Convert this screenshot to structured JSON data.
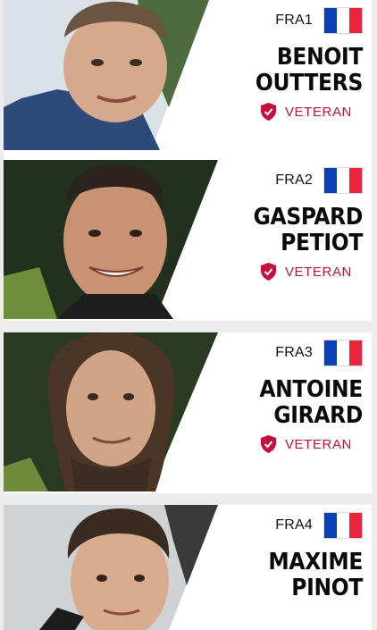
{
  "athletes": [
    {
      "bib": "FRA1",
      "first_name": "BENOIT",
      "last_name": "OUTTERS",
      "badge": "VETERAN",
      "flag_icon": "france-flag-icon"
    },
    {
      "bib": "FRA2",
      "first_name": "GASPARD",
      "last_name": "PETIOT",
      "badge": "VETERAN",
      "flag_icon": "france-flag-icon"
    },
    {
      "bib": "FRA3",
      "first_name": "ANTOINE",
      "last_name": "GIRARD",
      "badge": "VETERAN",
      "flag_icon": "france-flag-icon"
    },
    {
      "bib": "FRA4",
      "first_name": "MAXIME",
      "last_name": "PINOT",
      "badge": "",
      "flag_icon": "france-flag-icon"
    }
  ],
  "colors": {
    "accent": "#c4103c",
    "flag_blue": "#0b3fb5",
    "flag_white": "#ffffff",
    "flag_red": "#e8253a"
  }
}
